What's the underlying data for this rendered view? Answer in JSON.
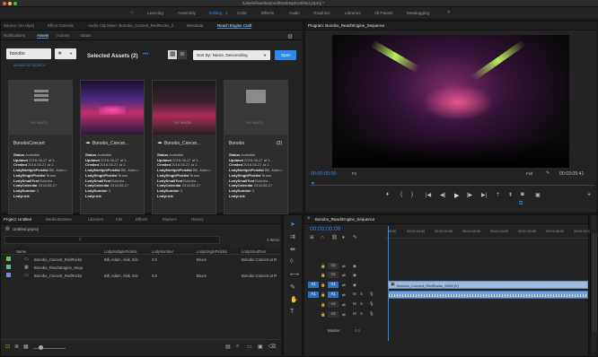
{
  "window": {
    "title": "/Users/lewisbeyond/Desktop/Untitled.prproj *"
  },
  "workspaces": [
    {
      "label": "Learning"
    },
    {
      "label": "Assembly"
    },
    {
      "label": "Editing"
    },
    {
      "label": "Color"
    },
    {
      "label": "Effects"
    },
    {
      "label": "Audio"
    },
    {
      "label": "Graphics"
    },
    {
      "label": "Libraries"
    },
    {
      "label": "All Panels"
    },
    {
      "label": "Metalogging"
    }
  ],
  "source_panel": {
    "tabs": [
      "Source: (no clips)",
      "Effect Controls",
      "Audio Clip Mixer: Bonobo_Concert_RedRocks_3",
      "Metadata",
      "Reach Engine Craft"
    ],
    "sub_tabs": [
      "Notifications",
      "Assets",
      "Actions",
      "Status"
    ],
    "search_value": "bonobo",
    "advanced": "ADVANCED SEARCH",
    "selected_label": "Selected Assets (2)",
    "sort_label": "Sort By: Name, Descending",
    "open_label": "Open",
    "cards": [
      {
        "title": "BonoboConcert",
        "no_image": "NO IMAGE",
        "status": "Available",
        "updated": "2018-06-27 at 1...",
        "created": "2018-06-27 at 1...",
        "multi": "Bill, Adam...",
        "single": "Bruce",
        "small": "Bonobo...",
        "calendar": "2018-06-27",
        "number": "3",
        "link": ""
      },
      {
        "title": "Bonobo_Concer...",
        "no_image": "",
        "status": "Available",
        "updated": "2018-06-27 at 1...",
        "created": "2018-06-27 at 1...",
        "multi": "Bill, Adam...",
        "single": "Bruce",
        "small": "Bonobo...",
        "calendar": "2018-06-27",
        "number": "3",
        "link": ""
      },
      {
        "title": "Bonobo_Concer...",
        "no_image": "NO IMAGE",
        "status": "Available",
        "updated": "2018-06-27 at 1...",
        "created": "2018-06-27 at 1...",
        "multi": "Bill, Adam...",
        "single": "Bruce",
        "small": "Bonobo...",
        "calendar": "2018-06-27",
        "number": "3",
        "link": ""
      },
      {
        "title": "Bonobo",
        "no_image": "NO IMAGE",
        "count": "(2)",
        "status": "Available",
        "updated": "2018-06-27 at 1...",
        "created": "2018-06-27 at 1...",
        "multi": "Bill, Adam...",
        "single": "Bruce",
        "small": "Bonobo...",
        "calendar": "2018-06-27",
        "number": "3",
        "link": ""
      }
    ],
    "field_labels": {
      "status": "Status",
      "updated": "Updated",
      "created": "Created",
      "multi": "LodyMultiplePicklist",
      "single": "LodySinglePicklist",
      "small": "LodySmallText",
      "calendar": "LodyCalendar",
      "number": "LodyNumber",
      "link": "LodyLink"
    }
  },
  "program": {
    "title": "Program: Bonobo_ReachEngine_Sequence",
    "timecode": "00:00:00:00",
    "fit": "Fit",
    "full": "Full",
    "duration": "00:03:09:41"
  },
  "project": {
    "tabs": [
      "Project: Untitled",
      "Media Browser",
      "Libraries",
      "Info",
      "Effects",
      "Markers",
      "History"
    ],
    "file": "Untitled.prproj",
    "items_count": "3 Items",
    "columns": [
      "Name",
      "LodyMultiplePicklist",
      "LodyNumber",
      "LodySinglePicklist",
      "LodySmallText"
    ],
    "rows": [
      {
        "name": "Bonobo_Concert_RedRocks",
        "multi": "Bill, Adam, Alok, Eric",
        "num": "3.0",
        "single": "Bruce",
        "small": "Bonobo Concert at R"
      },
      {
        "name": "Bonobo_ReachEngine_Sequ",
        "multi": "",
        "num": "",
        "single": "",
        "small": ""
      },
      {
        "name": "Bonobo_Concert_RedRocks",
        "multi": "Bill, Adam, Alok, Eric",
        "num": "3.0",
        "single": "Bruce",
        "small": "Bonobo Concert at R"
      }
    ]
  },
  "timeline": {
    "title": "Bonobo_ReachEngine_Sequence",
    "timecode": "00:00:00:00",
    "ruler": [
      "00:00",
      "00:00:16:00",
      "00:00:32:00",
      "00:00:48:00",
      "00:01:04:00",
      "00:01:20:00",
      "00:01:36:00",
      "00:01:52:00"
    ],
    "tracks": [
      "V3",
      "V2",
      "V1",
      "A1",
      "A2",
      "A3"
    ],
    "src_v": "V1",
    "src_a": "A1",
    "master": "Master",
    "master_val": "0.0",
    "clip_label": "Bonobo_Concert_RedRocks_1080i [V]"
  },
  "colors": {
    "accent": "#2d8ceb",
    "clip_video": "#9bbbe0",
    "clip_audio": "#6f9fd4"
  }
}
